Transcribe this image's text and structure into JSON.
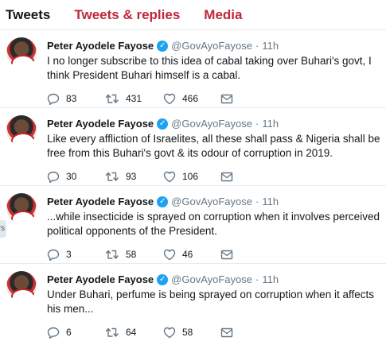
{
  "tabs": [
    {
      "label": "Tweets",
      "active": true
    },
    {
      "label": "Tweets & replies",
      "active": false
    },
    {
      "label": "Media",
      "active": false
    }
  ],
  "colors": {
    "accent": "#c0273e",
    "verified": "#1da1f2",
    "muted": "#657786",
    "text": "#14171a"
  },
  "side_tab": {
    "label": "rs"
  },
  "tweets": [
    {
      "author": "Peter Ayodele Fayose",
      "handle": "@GovAyoFayose",
      "separator": "·",
      "time": "11h",
      "text": "I no longer subscribe to this idea of cabal taking over Buhari's govt, I think President Buhari himself is a cabal.",
      "replies": "83",
      "retweets": "431",
      "likes": "466"
    },
    {
      "author": "Peter Ayodele Fayose",
      "handle": "@GovAyoFayose",
      "separator": "·",
      "time": "11h",
      "text": "Like every affliction of Israelites, all these shall pass & Nigeria shall be free from this Buhari's govt & its odour of corruption in 2019.",
      "replies": "30",
      "retweets": "93",
      "likes": "106"
    },
    {
      "author": "Peter Ayodele Fayose",
      "handle": "@GovAyoFayose",
      "separator": "·",
      "time": "11h",
      "text": "...while insecticide is sprayed on corruption when it involves perceived political opponents of the President.",
      "replies": "3",
      "retweets": "58",
      "likes": "46"
    },
    {
      "author": "Peter Ayodele Fayose",
      "handle": "@GovAyoFayose",
      "separator": "·",
      "time": "11h",
      "text": "Under Buhari, perfume is being sprayed on corruption when it affects his men...",
      "replies": "6",
      "retweets": "64",
      "likes": "58"
    }
  ]
}
